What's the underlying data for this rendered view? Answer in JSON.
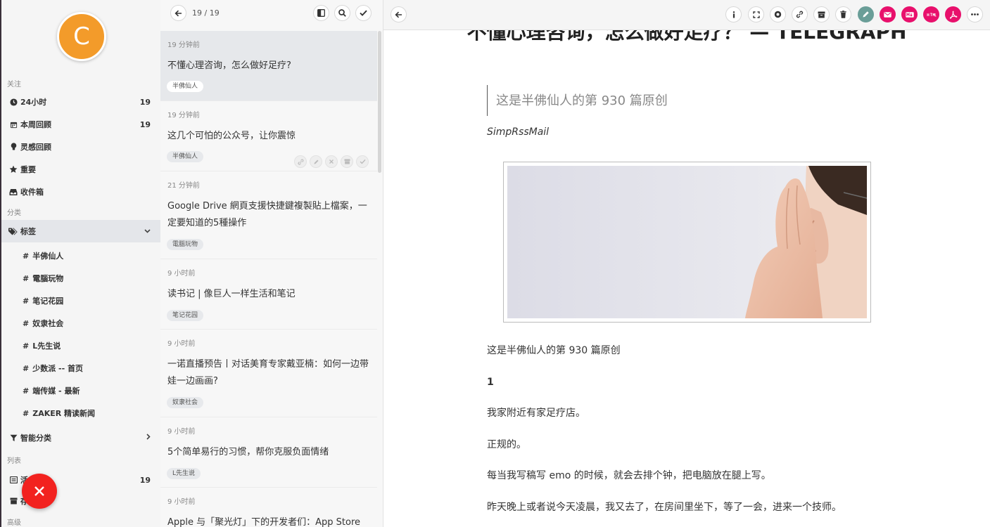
{
  "sidebar": {
    "avatar_letter": "C",
    "section_follow": "关注",
    "section_category": "分类",
    "section_list": "列表",
    "section_advanced": "高级",
    "nav": {
      "last24h": {
        "label": "24小时",
        "count": "19"
      },
      "week_review": {
        "label": "本周回顾",
        "count": "19"
      },
      "inspiration": {
        "label": "灵感回顾"
      },
      "important": {
        "label": "重要"
      },
      "inbox": {
        "label": "收件箱"
      },
      "tags": {
        "label": "标签"
      },
      "smart": {
        "label": "智能分类"
      },
      "active": {
        "label": "活",
        "count": "19"
      },
      "saved": {
        "label": "存"
      }
    },
    "tags": [
      {
        "label": "半佛仙人"
      },
      {
        "label": "電腦玩物"
      },
      {
        "label": "笔记花园"
      },
      {
        "label": "奴隶社会"
      },
      {
        "label": "L先生说"
      },
      {
        "label": "少数派 -- 首页"
      },
      {
        "label": "端传媒 - 最新"
      },
      {
        "label": "ZAKER 精读新闻"
      }
    ]
  },
  "list": {
    "count": "19 / 19",
    "items": [
      {
        "time": "19 分钟前",
        "title": "不懂心理咨询，怎么做好足疗?",
        "tag": "半佛仙人"
      },
      {
        "time": "19 分钟前",
        "title": "这几个可怕的公众号，让你震惊",
        "tag": "半佛仙人"
      },
      {
        "time": "21 分钟前",
        "title": "Google Drive 網頁支援快捷鍵複製貼上檔案，一定要知道的5種操作",
        "tag": "電腦玩物"
      },
      {
        "time": "9 小时前",
        "title": "读书记 | 像巨人一样生活和笔记",
        "tag": "笔记花园"
      },
      {
        "time": "9 小时前",
        "title": "一诺直播预告丨对话美育专家戴亚楠：如何一边带娃一边画画?",
        "tag": "奴隶社会"
      },
      {
        "time": "9 小时前",
        "title": "5个简单易行的习惯，帮你克服负面情绪",
        "tag": "L先生说"
      },
      {
        "time": "9 小时前",
        "title": "Apple 与「聚光灯」下的开发者们：App Store",
        "tag": ""
      }
    ]
  },
  "article": {
    "title": "不懂心理咨询，怎么做好足疗？ — TELEGRAPH",
    "quote": "这是半佛仙人的第 930 篇原创",
    "byline": "SimpRssMail",
    "paragraphs": [
      "这是半佛仙人的第 930 篇原创",
      "1",
      "我家附近有家足疗店。",
      "正规的。",
      "每当我写稿写 emo 的时候，就会去排个钟，把电脑放在腿上写。",
      "昨天晚上或者说今天凌晨，我又去了，在房间里坐下，等了一会，进来一个技师。"
    ]
  },
  "colors": {
    "avatar": "#f39b2a",
    "fab": "#f2221f",
    "accent_pink": "#e8106c",
    "accent_teal": "#6a9e98"
  }
}
